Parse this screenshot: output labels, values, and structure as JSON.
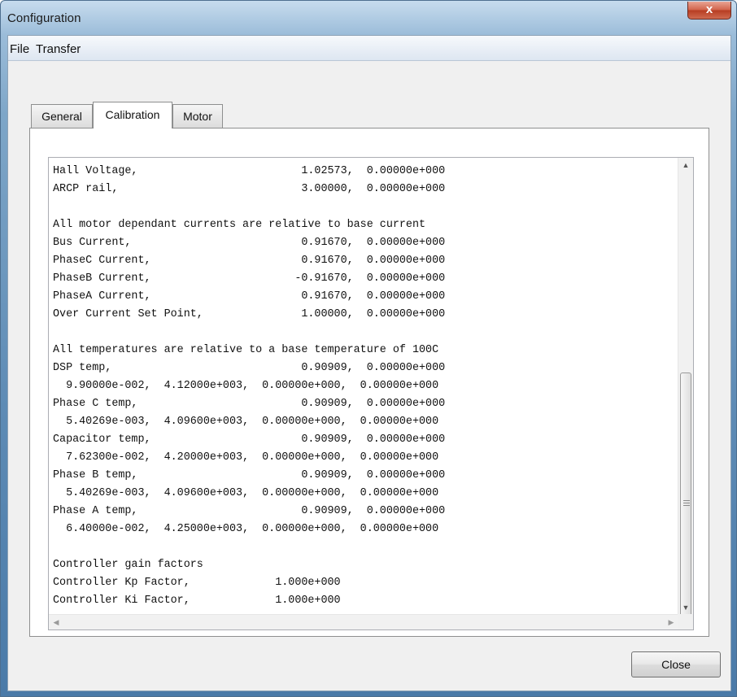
{
  "window": {
    "title": "Configuration",
    "close_glyph": "x"
  },
  "menu": {
    "items": [
      "File",
      "Transfer"
    ]
  },
  "tabs": [
    {
      "label": "General",
      "selected": false
    },
    {
      "label": "Calibration",
      "selected": true
    },
    {
      "label": "Motor",
      "selected": false
    }
  ],
  "calibration": {
    "lines": [
      "Hall Voltage,                         1.02573,  0.00000e+000",
      "ARCP rail,                            3.00000,  0.00000e+000",
      "",
      "All motor dependant currents are relative to base current",
      "Bus Current,                          0.91670,  0.00000e+000",
      "PhaseC Current,                       0.91670,  0.00000e+000",
      "PhaseB Current,                      -0.91670,  0.00000e+000",
      "PhaseA Current,                       0.91670,  0.00000e+000",
      "Over Current Set Point,               1.00000,  0.00000e+000",
      "",
      "All temperatures are relative to a base temperature of 100C",
      "DSP temp,                             0.90909,  0.00000e+000",
      "  9.90000e-002,  4.12000e+003,  0.00000e+000,  0.00000e+000",
      "Phase C temp,                         0.90909,  0.00000e+000",
      "  5.40269e-003,  4.09600e+003,  0.00000e+000,  0.00000e+000",
      "Capacitor temp,                       0.90909,  0.00000e+000",
      "  7.62300e-002,  4.20000e+003,  0.00000e+000,  0.00000e+000",
      "Phase B temp,                         0.90909,  0.00000e+000",
      "  5.40269e-003,  4.09600e+003,  0.00000e+000,  0.00000e+000",
      "Phase A temp,                         0.90909,  0.00000e+000",
      "  6.40000e-002,  4.25000e+003,  0.00000e+000,  0.00000e+000",
      "",
      "Controller gain factors",
      "Controller Kp Factor,             1.000e+000",
      "Controller Ki Factor,             1.000e+000"
    ]
  },
  "scrollbars": {
    "vertical": {
      "up": "up-arrow-icon",
      "down": "down-arrow-icon",
      "thumb_icon": "grip-icon",
      "position": "bottom"
    },
    "horizontal": {
      "left": "left-arrow-icon",
      "right": "right-arrow-icon"
    }
  },
  "buttons": {
    "close_label": "Close"
  }
}
